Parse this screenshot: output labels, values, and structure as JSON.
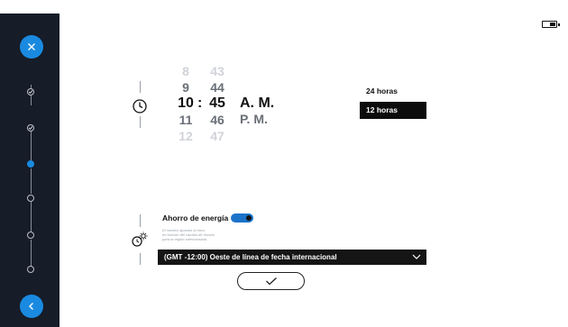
{
  "sidebar": {
    "close_icon": "close-icon",
    "back_icon": "chevron-left-icon",
    "accent_color": "#1a8ae0",
    "steps": [
      {
        "state": "done"
      },
      {
        "state": "done"
      },
      {
        "state": "current"
      },
      {
        "state": "pending"
      },
      {
        "state": "pending"
      },
      {
        "state": "pending"
      }
    ]
  },
  "status": {
    "battery_icon": "battery-icon"
  },
  "time": {
    "hours": [
      "8",
      "9",
      "10",
      "11",
      "12"
    ],
    "separator": ":",
    "minutes": [
      "43",
      "44",
      "45",
      "46",
      "47"
    ],
    "meridiem": [
      "A. M.",
      "P. M."
    ],
    "formats": {
      "h24": "24 horas",
      "h12": "12 horas",
      "selected": "12 horas"
    }
  },
  "energy": {
    "title": "Ahorro de energía",
    "enabled": true,
    "description": [
      "El monitor ajustará la hora",
      "en función del cambio de horario",
      "para la región seleccionada."
    ],
    "timezone": "(GMT -12:00) Oeste de línea de fecha internacional"
  },
  "confirm_icon": "checkmark-icon"
}
